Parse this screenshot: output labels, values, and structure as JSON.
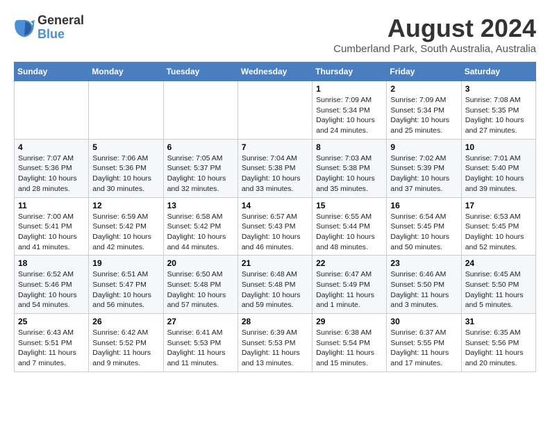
{
  "logo": {
    "general": "General",
    "blue": "Blue"
  },
  "title": "August 2024",
  "subtitle": "Cumberland Park, South Australia, Australia",
  "headers": [
    "Sunday",
    "Monday",
    "Tuesday",
    "Wednesday",
    "Thursday",
    "Friday",
    "Saturday"
  ],
  "weeks": [
    [
      {
        "day": "",
        "info": ""
      },
      {
        "day": "",
        "info": ""
      },
      {
        "day": "",
        "info": ""
      },
      {
        "day": "",
        "info": ""
      },
      {
        "day": "1",
        "info": "Sunrise: 7:09 AM\nSunset: 5:34 PM\nDaylight: 10 hours\nand 24 minutes."
      },
      {
        "day": "2",
        "info": "Sunrise: 7:09 AM\nSunset: 5:34 PM\nDaylight: 10 hours\nand 25 minutes."
      },
      {
        "day": "3",
        "info": "Sunrise: 7:08 AM\nSunset: 5:35 PM\nDaylight: 10 hours\nand 27 minutes."
      }
    ],
    [
      {
        "day": "4",
        "info": "Sunrise: 7:07 AM\nSunset: 5:36 PM\nDaylight: 10 hours\nand 28 minutes."
      },
      {
        "day": "5",
        "info": "Sunrise: 7:06 AM\nSunset: 5:36 PM\nDaylight: 10 hours\nand 30 minutes."
      },
      {
        "day": "6",
        "info": "Sunrise: 7:05 AM\nSunset: 5:37 PM\nDaylight: 10 hours\nand 32 minutes."
      },
      {
        "day": "7",
        "info": "Sunrise: 7:04 AM\nSunset: 5:38 PM\nDaylight: 10 hours\nand 33 minutes."
      },
      {
        "day": "8",
        "info": "Sunrise: 7:03 AM\nSunset: 5:38 PM\nDaylight: 10 hours\nand 35 minutes."
      },
      {
        "day": "9",
        "info": "Sunrise: 7:02 AM\nSunset: 5:39 PM\nDaylight: 10 hours\nand 37 minutes."
      },
      {
        "day": "10",
        "info": "Sunrise: 7:01 AM\nSunset: 5:40 PM\nDaylight: 10 hours\nand 39 minutes."
      }
    ],
    [
      {
        "day": "11",
        "info": "Sunrise: 7:00 AM\nSunset: 5:41 PM\nDaylight: 10 hours\nand 41 minutes."
      },
      {
        "day": "12",
        "info": "Sunrise: 6:59 AM\nSunset: 5:42 PM\nDaylight: 10 hours\nand 42 minutes."
      },
      {
        "day": "13",
        "info": "Sunrise: 6:58 AM\nSunset: 5:42 PM\nDaylight: 10 hours\nand 44 minutes."
      },
      {
        "day": "14",
        "info": "Sunrise: 6:57 AM\nSunset: 5:43 PM\nDaylight: 10 hours\nand 46 minutes."
      },
      {
        "day": "15",
        "info": "Sunrise: 6:55 AM\nSunset: 5:44 PM\nDaylight: 10 hours\nand 48 minutes."
      },
      {
        "day": "16",
        "info": "Sunrise: 6:54 AM\nSunset: 5:45 PM\nDaylight: 10 hours\nand 50 minutes."
      },
      {
        "day": "17",
        "info": "Sunrise: 6:53 AM\nSunset: 5:45 PM\nDaylight: 10 hours\nand 52 minutes."
      }
    ],
    [
      {
        "day": "18",
        "info": "Sunrise: 6:52 AM\nSunset: 5:46 PM\nDaylight: 10 hours\nand 54 minutes."
      },
      {
        "day": "19",
        "info": "Sunrise: 6:51 AM\nSunset: 5:47 PM\nDaylight: 10 hours\nand 56 minutes."
      },
      {
        "day": "20",
        "info": "Sunrise: 6:50 AM\nSunset: 5:48 PM\nDaylight: 10 hours\nand 57 minutes."
      },
      {
        "day": "21",
        "info": "Sunrise: 6:48 AM\nSunset: 5:48 PM\nDaylight: 10 hours\nand 59 minutes."
      },
      {
        "day": "22",
        "info": "Sunrise: 6:47 AM\nSunset: 5:49 PM\nDaylight: 11 hours\nand 1 minute."
      },
      {
        "day": "23",
        "info": "Sunrise: 6:46 AM\nSunset: 5:50 PM\nDaylight: 11 hours\nand 3 minutes."
      },
      {
        "day": "24",
        "info": "Sunrise: 6:45 AM\nSunset: 5:50 PM\nDaylight: 11 hours\nand 5 minutes."
      }
    ],
    [
      {
        "day": "25",
        "info": "Sunrise: 6:43 AM\nSunset: 5:51 PM\nDaylight: 11 hours\nand 7 minutes."
      },
      {
        "day": "26",
        "info": "Sunrise: 6:42 AM\nSunset: 5:52 PM\nDaylight: 11 hours\nand 9 minutes."
      },
      {
        "day": "27",
        "info": "Sunrise: 6:41 AM\nSunset: 5:53 PM\nDaylight: 11 hours\nand 11 minutes."
      },
      {
        "day": "28",
        "info": "Sunrise: 6:39 AM\nSunset: 5:53 PM\nDaylight: 11 hours\nand 13 minutes."
      },
      {
        "day": "29",
        "info": "Sunrise: 6:38 AM\nSunset: 5:54 PM\nDaylight: 11 hours\nand 15 minutes."
      },
      {
        "day": "30",
        "info": "Sunrise: 6:37 AM\nSunset: 5:55 PM\nDaylight: 11 hours\nand 17 minutes."
      },
      {
        "day": "31",
        "info": "Sunrise: 6:35 AM\nSunset: 5:56 PM\nDaylight: 11 hours\nand 20 minutes."
      }
    ]
  ]
}
